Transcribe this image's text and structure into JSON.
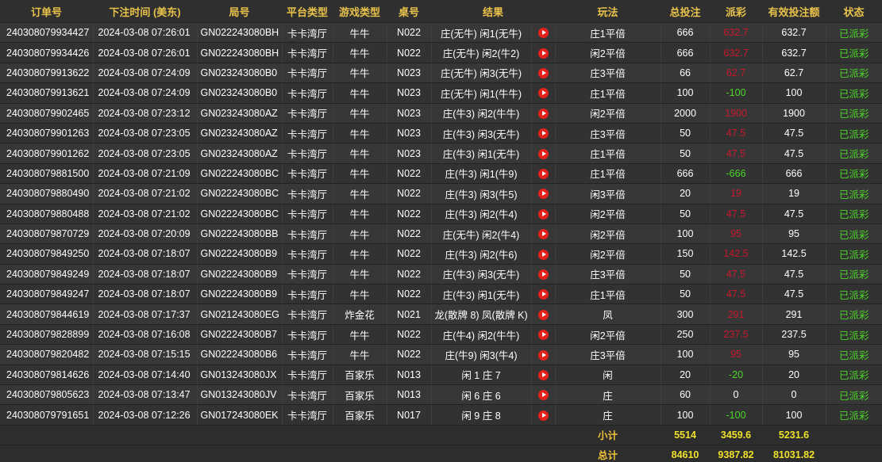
{
  "columns": {
    "order": "订单号",
    "time": "下注时间 (美东)",
    "round": "局号",
    "platform": "平台类型",
    "game": "游戏类型",
    "table": "桌号",
    "result": "结果",
    "play": "玩法",
    "bet": "总投注",
    "payout": "派彩",
    "valid": "有效投注额",
    "status": "状态"
  },
  "colors": {
    "header_text": "#e8c24a",
    "loss": "#c8182c",
    "win": "#4bd626",
    "status": "#4bd626",
    "summary": "#f0e12a",
    "play_icon": "#e5211c"
  },
  "rows": [
    {
      "order": "240308079934427",
      "time": "2024-03-08 07:26:01",
      "round": "GN022243080BH",
      "platform": "卡卡湾厅",
      "game": "牛牛",
      "table": "N022",
      "result": "庄(无牛) 闲1(无牛)",
      "play": "庄1平倍",
      "bet": "666",
      "payout": "632.7",
      "payout_tone": "red",
      "valid": "632.7",
      "status": "已派彩"
    },
    {
      "order": "240308079934426",
      "time": "2024-03-08 07:26:01",
      "round": "GN022243080BH",
      "platform": "卡卡湾厅",
      "game": "牛牛",
      "table": "N022",
      "result": "庄(无牛) 闲2(牛2)",
      "play": "闲2平倍",
      "bet": "666",
      "payout": "632.7",
      "payout_tone": "red",
      "valid": "632.7",
      "status": "已派彩"
    },
    {
      "order": "240308079913622",
      "time": "2024-03-08 07:24:09",
      "round": "GN023243080B0",
      "platform": "卡卡湾厅",
      "game": "牛牛",
      "table": "N023",
      "result": "庄(无牛) 闲3(无牛)",
      "play": "庄3平倍",
      "bet": "66",
      "payout": "62.7",
      "payout_tone": "red",
      "valid": "62.7",
      "status": "已派彩"
    },
    {
      "order": "240308079913621",
      "time": "2024-03-08 07:24:09",
      "round": "GN023243080B0",
      "platform": "卡卡湾厅",
      "game": "牛牛",
      "table": "N023",
      "result": "庄(无牛) 闲1(牛牛)",
      "play": "庄1平倍",
      "bet": "100",
      "payout": "-100",
      "payout_tone": "green",
      "valid": "100",
      "status": "已派彩"
    },
    {
      "order": "240308079902465",
      "time": "2024-03-08 07:23:12",
      "round": "GN023243080AZ",
      "platform": "卡卡湾厅",
      "game": "牛牛",
      "table": "N023",
      "result": "庄(牛3) 闲2(牛牛)",
      "play": "闲2平倍",
      "bet": "2000",
      "payout": "1900",
      "payout_tone": "red",
      "valid": "1900",
      "status": "已派彩"
    },
    {
      "order": "240308079901263",
      "time": "2024-03-08 07:23:05",
      "round": "GN023243080AZ",
      "platform": "卡卡湾厅",
      "game": "牛牛",
      "table": "N023",
      "result": "庄(牛3) 闲3(无牛)",
      "play": "庄3平倍",
      "bet": "50",
      "payout": "47.5",
      "payout_tone": "red",
      "valid": "47.5",
      "status": "已派彩"
    },
    {
      "order": "240308079901262",
      "time": "2024-03-08 07:23:05",
      "round": "GN023243080AZ",
      "platform": "卡卡湾厅",
      "game": "牛牛",
      "table": "N023",
      "result": "庄(牛3) 闲1(无牛)",
      "play": "庄1平倍",
      "bet": "50",
      "payout": "47.5",
      "payout_tone": "red",
      "valid": "47.5",
      "status": "已派彩"
    },
    {
      "order": "240308079881500",
      "time": "2024-03-08 07:21:09",
      "round": "GN022243080BC",
      "platform": "卡卡湾厅",
      "game": "牛牛",
      "table": "N022",
      "result": "庄(牛3) 闲1(牛9)",
      "play": "庄1平倍",
      "bet": "666",
      "payout": "-666",
      "payout_tone": "green",
      "valid": "666",
      "status": "已派彩"
    },
    {
      "order": "240308079880490",
      "time": "2024-03-08 07:21:02",
      "round": "GN022243080BC",
      "platform": "卡卡湾厅",
      "game": "牛牛",
      "table": "N022",
      "result": "庄(牛3) 闲3(牛5)",
      "play": "闲3平倍",
      "bet": "20",
      "payout": "19",
      "payout_tone": "red",
      "valid": "19",
      "status": "已派彩"
    },
    {
      "order": "240308079880488",
      "time": "2024-03-08 07:21:02",
      "round": "GN022243080BC",
      "platform": "卡卡湾厅",
      "game": "牛牛",
      "table": "N022",
      "result": "庄(牛3) 闲2(牛4)",
      "play": "闲2平倍",
      "bet": "50",
      "payout": "47.5",
      "payout_tone": "red",
      "valid": "47.5",
      "status": "已派彩"
    },
    {
      "order": "240308079870729",
      "time": "2024-03-08 07:20:09",
      "round": "GN022243080BB",
      "platform": "卡卡湾厅",
      "game": "牛牛",
      "table": "N022",
      "result": "庄(无牛) 闲2(牛4)",
      "play": "闲2平倍",
      "bet": "100",
      "payout": "95",
      "payout_tone": "red",
      "valid": "95",
      "status": "已派彩"
    },
    {
      "order": "240308079849250",
      "time": "2024-03-08 07:18:07",
      "round": "GN022243080B9",
      "platform": "卡卡湾厅",
      "game": "牛牛",
      "table": "N022",
      "result": "庄(牛3) 闲2(牛6)",
      "play": "闲2平倍",
      "bet": "150",
      "payout": "142.5",
      "payout_tone": "red",
      "valid": "142.5",
      "status": "已派彩"
    },
    {
      "order": "240308079849249",
      "time": "2024-03-08 07:18:07",
      "round": "GN022243080B9",
      "platform": "卡卡湾厅",
      "game": "牛牛",
      "table": "N022",
      "result": "庄(牛3) 闲3(无牛)",
      "play": "庄3平倍",
      "bet": "50",
      "payout": "47.5",
      "payout_tone": "red",
      "valid": "47.5",
      "status": "已派彩"
    },
    {
      "order": "240308079849247",
      "time": "2024-03-08 07:18:07",
      "round": "GN022243080B9",
      "platform": "卡卡湾厅",
      "game": "牛牛",
      "table": "N022",
      "result": "庄(牛3) 闲1(无牛)",
      "play": "庄1平倍",
      "bet": "50",
      "payout": "47.5",
      "payout_tone": "red",
      "valid": "47.5",
      "status": "已派彩"
    },
    {
      "order": "240308079844619",
      "time": "2024-03-08 07:17:37",
      "round": "GN021243080EG",
      "platform": "卡卡湾厅",
      "game": "炸金花",
      "table": "N021",
      "result": "龙(散牌 8) 凤(散牌 K)",
      "play": "凤",
      "bet": "300",
      "payout": "291",
      "payout_tone": "red",
      "valid": "291",
      "status": "已派彩"
    },
    {
      "order": "240308079828899",
      "time": "2024-03-08 07:16:08",
      "round": "GN022243080B7",
      "platform": "卡卡湾厅",
      "game": "牛牛",
      "table": "N022",
      "result": "庄(牛4) 闲2(牛牛)",
      "play": "闲2平倍",
      "bet": "250",
      "payout": "237.5",
      "payout_tone": "red",
      "valid": "237.5",
      "status": "已派彩"
    },
    {
      "order": "240308079820482",
      "time": "2024-03-08 07:15:15",
      "round": "GN022243080B6",
      "platform": "卡卡湾厅",
      "game": "牛牛",
      "table": "N022",
      "result": "庄(牛9) 闲3(牛4)",
      "play": "庄3平倍",
      "bet": "100",
      "payout": "95",
      "payout_tone": "red",
      "valid": "95",
      "status": "已派彩"
    },
    {
      "order": "240308079814626",
      "time": "2024-03-08 07:14:40",
      "round": "GN013243080JX",
      "platform": "卡卡湾厅",
      "game": "百家乐",
      "table": "N013",
      "result": "闲 1 庄 7",
      "play": "闲",
      "bet": "20",
      "payout": "-20",
      "payout_tone": "green",
      "valid": "20",
      "status": "已派彩"
    },
    {
      "order": "240308079805623",
      "time": "2024-03-08 07:13:47",
      "round": "GN013243080JV",
      "platform": "卡卡湾厅",
      "game": "百家乐",
      "table": "N013",
      "result": "闲 6 庄 6",
      "play": "庄",
      "bet": "60",
      "payout": "0",
      "payout_tone": "white",
      "valid": "0",
      "status": "已派彩"
    },
    {
      "order": "240308079791651",
      "time": "2024-03-08 07:12:26",
      "round": "GN017243080EK",
      "platform": "卡卡湾厅",
      "game": "百家乐",
      "table": "N017",
      "result": "闲 9 庄 8",
      "play": "庄",
      "bet": "100",
      "payout": "-100",
      "payout_tone": "green",
      "valid": "100",
      "status": "已派彩"
    }
  ],
  "subtotal": {
    "label": "小计",
    "bet": "5514",
    "payout": "3459.6",
    "valid": "5231.6"
  },
  "total": {
    "label": "总计",
    "bet": "84610",
    "payout": "9387.82",
    "valid": "81031.82"
  },
  "icons": {
    "replay": "play-icon"
  }
}
